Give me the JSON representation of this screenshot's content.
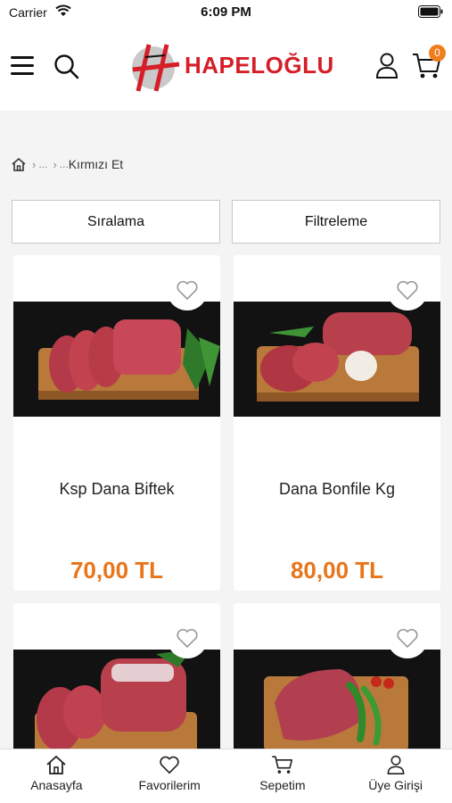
{
  "status": {
    "carrier": "Carrier",
    "time": "6:09 PM"
  },
  "header": {
    "brand": "HAPELOĞLU",
    "cart_count": "0"
  },
  "breadcrumb": {
    "ellipsis1": "...",
    "ellipsis2": "...",
    "current": "Kırmızı Et"
  },
  "toolbar": {
    "sort_label": "Sıralama",
    "filter_label": "Filtreleme"
  },
  "products": [
    {
      "name": "Ksp Dana Biftek",
      "price": "70,00 TL"
    },
    {
      "name": "Dana Bonfile Kg",
      "price": "80,00 TL"
    },
    {
      "name": "",
      "price": ""
    },
    {
      "name": "",
      "price": ""
    }
  ],
  "tabs": [
    {
      "label": "Anasayfa",
      "icon": "home-icon"
    },
    {
      "label": "Favorilerim",
      "icon": "heart-icon"
    },
    {
      "label": "Sepetim",
      "icon": "cart-icon"
    },
    {
      "label": "Üye Girişi",
      "icon": "user-icon"
    }
  ],
  "colors": {
    "brand_red": "#d51e28",
    "price_orange": "#e8751a",
    "badge_orange": "#f07e1e"
  }
}
